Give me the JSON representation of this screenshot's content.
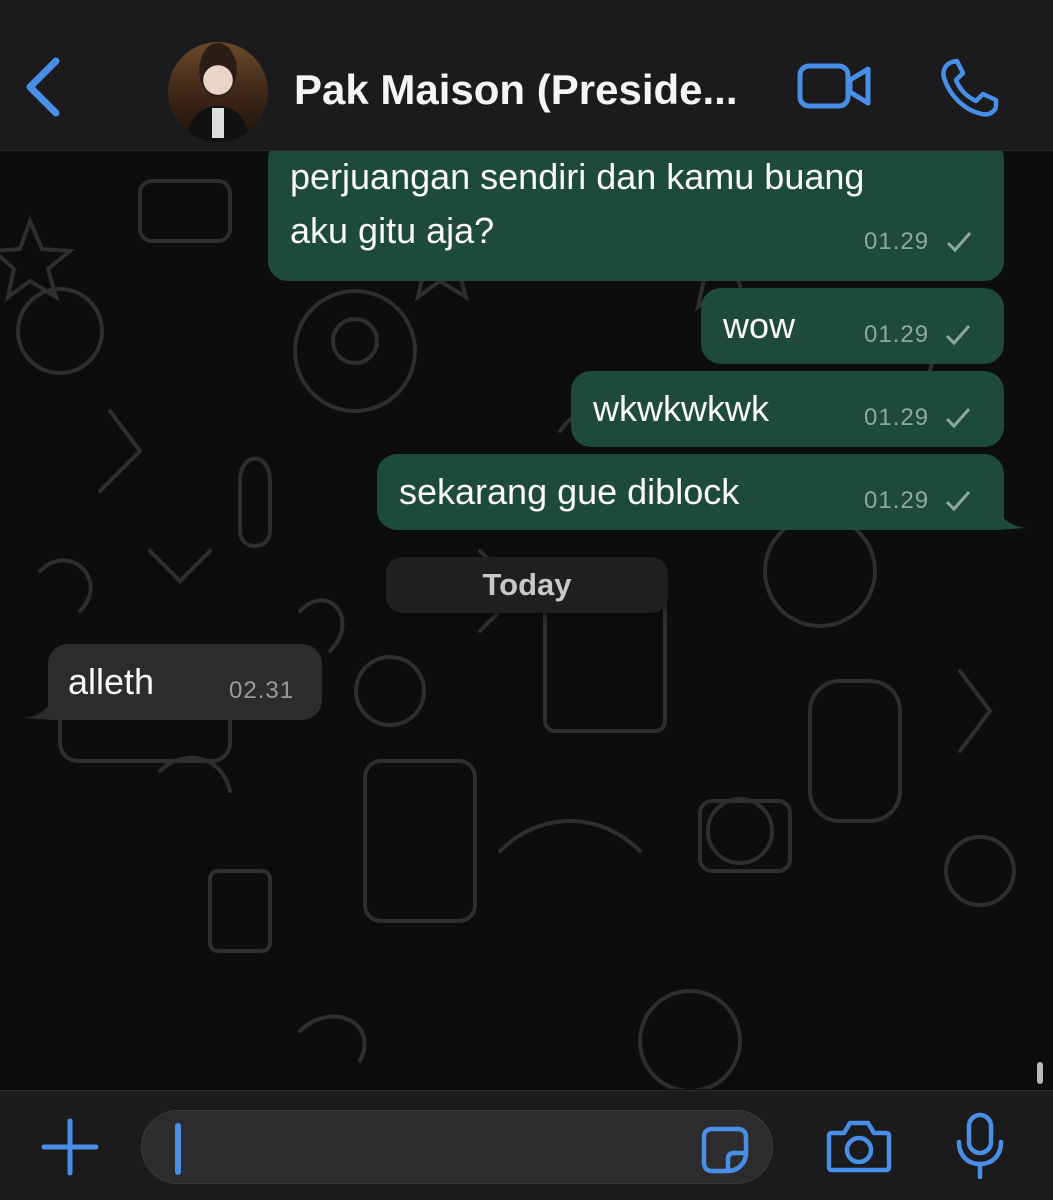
{
  "header": {
    "contact_name": "Pak Maison (Preside...",
    "icons": [
      "chevron-left-icon",
      "avatar",
      "video-camera-icon",
      "phone-icon"
    ],
    "accent_color": "#4a8fe7"
  },
  "messages": [
    {
      "direction": "outgoing",
      "text_lines": [
        "perjuangan sendiri dan kamu buang",
        "aku gitu aja?"
      ],
      "time": "01.29",
      "status": "sent-check"
    },
    {
      "direction": "outgoing",
      "text": "wow",
      "time": "01.29",
      "status": "sent-check"
    },
    {
      "direction": "outgoing",
      "text": "wkwkwkwk",
      "time": "01.29",
      "status": "sent-check"
    },
    {
      "direction": "outgoing",
      "text": "sekarang gue diblock",
      "time": "01.29",
      "status": "sent-check"
    },
    {
      "direction": "incoming",
      "text": "alleth",
      "time": "02.31"
    }
  ],
  "date_separator": "Today",
  "input_bar": {
    "icons": [
      "plus-icon",
      "sticker-icon",
      "camera-icon",
      "microphone-icon"
    ],
    "message_value": ""
  },
  "colors": {
    "outgoing_bubble": "#1e4a3c",
    "incoming_bubble": "#2c2c2e",
    "bars": "#1b1b1d"
  }
}
